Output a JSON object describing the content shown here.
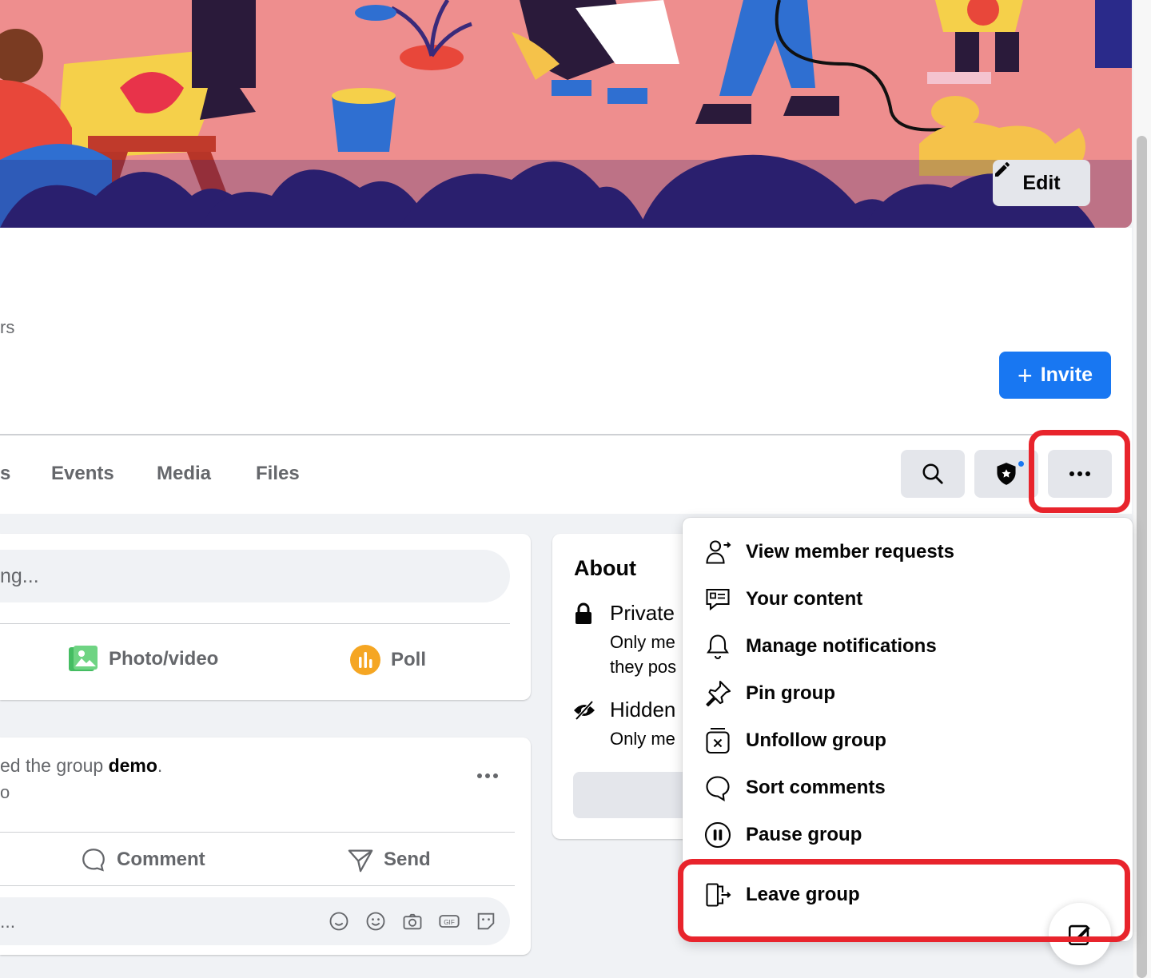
{
  "cover": {
    "edit_label": "Edit"
  },
  "header": {
    "members_fragment": "rs",
    "invite_label": "Invite"
  },
  "tabs": [
    {
      "label": "s"
    },
    {
      "label": "Events"
    },
    {
      "label": "Media"
    },
    {
      "label": "Files"
    }
  ],
  "composer": {
    "placeholder": "ng...",
    "actions": [
      {
        "label": "Photo/video",
        "icon": "photo-icon",
        "color": "#45bd62"
      },
      {
        "label": "Poll",
        "icon": "poll-icon",
        "color": "#f7b928"
      }
    ]
  },
  "post": {
    "text_prefix": "ed the group ",
    "group_name": "demo",
    "text_suffix": ".",
    "sub": "o",
    "actions": [
      {
        "label": "Comment",
        "icon": "comment-icon"
      },
      {
        "label": "Send",
        "icon": "send-icon"
      }
    ],
    "comment_placeholder": "..."
  },
  "about": {
    "title": "About",
    "rows": [
      {
        "title": "Private",
        "line1": "Only me",
        "line2": "they pos",
        "icon": "lock-icon"
      },
      {
        "title": "Hidden",
        "line1": "Only me",
        "icon": "eye-slash-icon"
      }
    ]
  },
  "menu": {
    "items": [
      {
        "label": "View member requests",
        "icon": "member-requests-icon"
      },
      {
        "label": "Your content",
        "icon": "content-icon"
      },
      {
        "label": "Manage notifications",
        "icon": "bell-icon"
      },
      {
        "label": "Pin group",
        "icon": "pin-icon"
      },
      {
        "label": "Unfollow group",
        "icon": "unfollow-icon"
      },
      {
        "label": "Sort comments",
        "icon": "comment-bubble-icon"
      },
      {
        "label": "Pause group",
        "icon": "pause-icon"
      },
      {
        "label": "Leave group",
        "icon": "leave-icon"
      }
    ]
  },
  "colors": {
    "accent": "#1877f2",
    "highlight": "#e8242c",
    "cover_bg": "#ee8e8e"
  }
}
